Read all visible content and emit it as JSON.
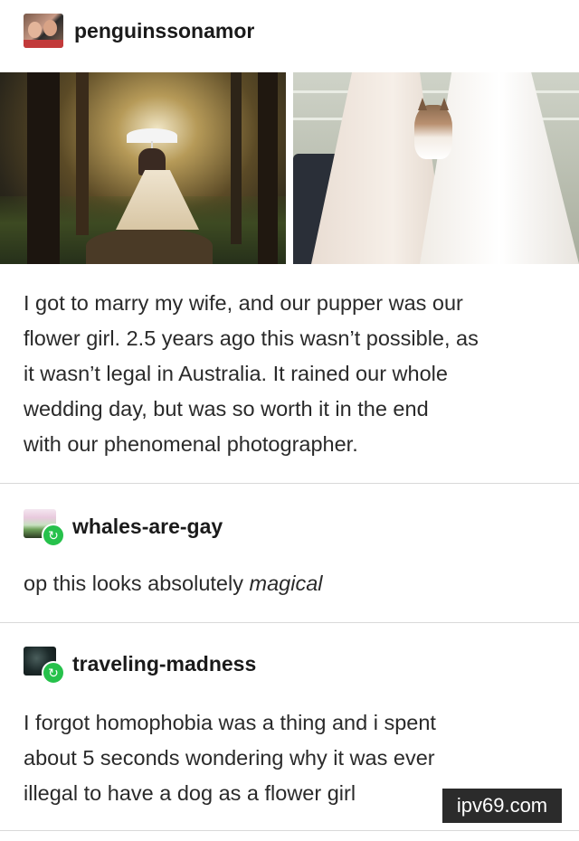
{
  "original_post": {
    "username": "penguinssonamor",
    "caption_lines": [
      "I got to marry my wife, and our pupper was our",
      "flower girl. 2.5 years ago this wasn’t possible, as",
      "it wasn’t legal in Australia. It rained our whole",
      "wedding day, but was so worth it in the end",
      "with our phenomenal photographer."
    ]
  },
  "replies": [
    {
      "username": "whales-are-gay",
      "body_prefix": "op this looks absolutely ",
      "body_emphasis": "magical"
    },
    {
      "username": "traveling-madness",
      "body_lines": [
        "I forgot homophobia was a thing and i spent",
        "about 5 seconds wondering why it was ever",
        "illegal to have a dog as a flower girl"
      ]
    }
  ],
  "watermark": "ipv69.com",
  "colors": {
    "reblog_badge": "#26c14b",
    "divider": "#d9d9d9",
    "watermark_bg": "#2b2b2b"
  },
  "icons": {
    "reblog": "reblog-icon"
  }
}
